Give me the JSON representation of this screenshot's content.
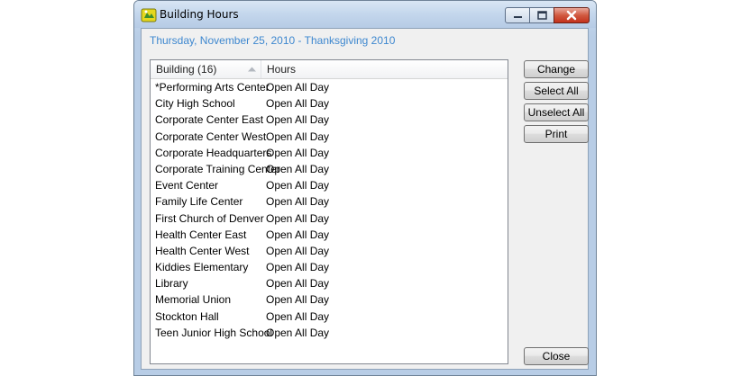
{
  "window": {
    "title": "Building Hours",
    "icon": "app-icon",
    "controls": [
      "minimize-icon",
      "maximize-icon",
      "close-icon"
    ]
  },
  "date_label": "Thursday, November 25, 2010 - Thanksgiving 2010",
  "list": {
    "columns": {
      "building": "Building (16)",
      "hours": "Hours"
    },
    "sort": "building-ascending",
    "rows": [
      {
        "building": "*Performing Arts Center",
        "hours": "Open All Day"
      },
      {
        "building": "City High School",
        "hours": "Open All Day"
      },
      {
        "building": "Corporate Center East",
        "hours": "Open All Day"
      },
      {
        "building": "Corporate Center West",
        "hours": "Open All Day"
      },
      {
        "building": "Corporate Headquarters",
        "hours": "Open All Day"
      },
      {
        "building": "Corporate Training Center",
        "hours": "Open All Day"
      },
      {
        "building": "Event Center",
        "hours": "Open All Day"
      },
      {
        "building": "Family Life Center",
        "hours": "Open All Day"
      },
      {
        "building": "First Church of Denver",
        "hours": "Open All Day"
      },
      {
        "building": "Health Center East",
        "hours": "Open All Day"
      },
      {
        "building": "Health Center West",
        "hours": "Open All Day"
      },
      {
        "building": "Kiddies Elementary",
        "hours": "Open All Day"
      },
      {
        "building": "Library",
        "hours": "Open All Day"
      },
      {
        "building": "Memorial Union",
        "hours": "Open All Day"
      },
      {
        "building": "Stockton Hall",
        "hours": "Open All Day"
      },
      {
        "building": "Teen Junior High School",
        "hours": "Open All Day"
      }
    ]
  },
  "buttons": {
    "change": "Change",
    "select_all": "Select All",
    "unselect_all": "Unselect All",
    "print": "Print",
    "close": "Close"
  },
  "colors": {
    "date_label": "#3d87cf",
    "close_button": "#c3321c"
  }
}
